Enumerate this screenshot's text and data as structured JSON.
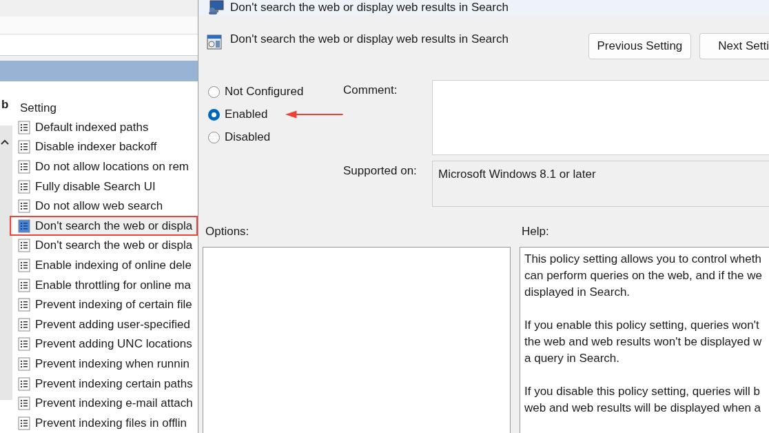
{
  "left_pane": {
    "partial_column_header": "b",
    "column_header": "Setting",
    "items": [
      {
        "label": "Default indexed paths",
        "selected": false
      },
      {
        "label": "Disable indexer backoff",
        "selected": false
      },
      {
        "label": "Do not allow locations on rem",
        "selected": false
      },
      {
        "label": "Fully disable Search UI",
        "selected": false
      },
      {
        "label": "Do not allow web search",
        "selected": false
      },
      {
        "label": "Don't search the web or displa",
        "selected": true
      },
      {
        "label": "Don't search the web or displa",
        "selected": false
      },
      {
        "label": "Enable indexing of online dele",
        "selected": false
      },
      {
        "label": "Enable throttling for online ma",
        "selected": false
      },
      {
        "label": "Prevent indexing of certain file",
        "selected": false
      },
      {
        "label": "Prevent adding user-specified",
        "selected": false
      },
      {
        "label": "Prevent adding UNC locations",
        "selected": false
      },
      {
        "label": "Prevent indexing when runnin",
        "selected": false
      },
      {
        "label": "Prevent indexing certain paths",
        "selected": false
      },
      {
        "label": "Prevent indexing e-mail attach",
        "selected": false
      },
      {
        "label": "Prevent indexing files in offlin",
        "selected": false
      }
    ]
  },
  "dialog": {
    "title": "Don't search the web or display web results in Search",
    "heading": "Don't search the web or display web results in Search",
    "buttons": [
      "Previous Setting",
      "Next Setti"
    ],
    "states": [
      {
        "label": "Not Configured",
        "selected": false
      },
      {
        "label": "Enabled",
        "selected": true
      },
      {
        "label": "Disabled",
        "selected": false
      }
    ],
    "comment_label": "Comment:",
    "supported_label": "Supported on:",
    "supported_value": "Microsoft Windows 8.1 or later",
    "options_label": "Options:",
    "help_label": "Help:",
    "help_paragraphs": [
      [
        "This policy setting allows you to control wheth",
        "can perform queries on the web, and if the we",
        "displayed in Search."
      ],
      [
        "If you enable this policy setting, queries won't",
        "the web and web results won't be displayed w",
        "a query in Search."
      ],
      [
        "If you disable this policy setting, queries will b",
        "web and web results will be displayed when a"
      ]
    ]
  }
}
